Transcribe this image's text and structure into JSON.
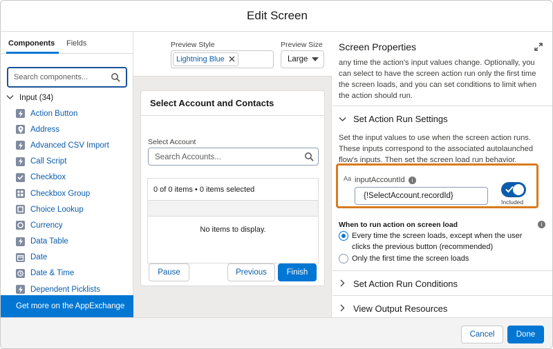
{
  "modal": {
    "title": "Edit Screen"
  },
  "left_panel": {
    "tabs": [
      {
        "label": "Components"
      },
      {
        "label": "Fields"
      }
    ],
    "search_placeholder": "Search components...",
    "group": {
      "label": "Input (34)"
    },
    "items": [
      {
        "label": "Action Button",
        "icon": "lightning-icon"
      },
      {
        "label": "Address",
        "icon": "location-icon"
      },
      {
        "label": "Advanced CSV Import",
        "icon": "lightning-icon"
      },
      {
        "label": "Call Script",
        "icon": "lightning-icon"
      },
      {
        "label": "Checkbox",
        "icon": "checkbox-icon"
      },
      {
        "label": "Checkbox Group",
        "icon": "checkbox-group-icon"
      },
      {
        "label": "Choice Lookup",
        "icon": "lookup-icon"
      },
      {
        "label": "Currency",
        "icon": "currency-icon"
      },
      {
        "label": "Data Table",
        "icon": "lightning-icon"
      },
      {
        "label": "Date",
        "icon": "calendar-icon"
      },
      {
        "label": "Date & Time",
        "icon": "clock-icon"
      },
      {
        "label": "Dependent Picklists",
        "icon": "lightning-icon"
      }
    ],
    "appexchange_label": "Get more on the AppExchange"
  },
  "preview": {
    "style_label": "Preview Style",
    "style_value": "Lightning Blue",
    "size_label": "Preview Size",
    "size_value": "Large",
    "card": {
      "title": "Select Account and Contacts",
      "select_account_label": "Select Account",
      "search_placeholder": "Search Accounts...",
      "table_status": "0 of 0 items • 0 items selected",
      "empty_text": "No items to display.",
      "pause_label": "Pause",
      "previous_label": "Previous",
      "finish_label": "Finish"
    }
  },
  "properties": {
    "title": "Screen Properties",
    "intro_text": "any time the action's input values change. Optionally, you can select to have the screen action run only the first time the screen loads, and you can set conditions to limit when the action should run.",
    "section_run_settings": "Set Action Run Settings",
    "run_settings_text": "Set the input values to use when the screen action runs. These inputs correspond to the associated autolaunched flow's inputs. Then set the screen load run behavior.",
    "input": {
      "type_badge": "Aa",
      "label": "inputAccountId",
      "value": "{!SelectAccount.recordId}",
      "toggle_label": "Included",
      "toggle_on": true
    },
    "when_label": "When to run action on screen load",
    "radio_options": [
      {
        "label": "Every time the screen loads, except when the user clicks the previous button (recommended)",
        "checked": true
      },
      {
        "label": "Only the first time the screen loads",
        "checked": false
      }
    ],
    "section_run_conditions": "Set Action Run Conditions",
    "section_output_resources": "View Output Resources"
  },
  "footer": {
    "cancel_label": "Cancel",
    "done_label": "Done"
  },
  "colors": {
    "brand": "#0176d3",
    "link": "#0b5cab",
    "highlight": "#d77b1e"
  }
}
